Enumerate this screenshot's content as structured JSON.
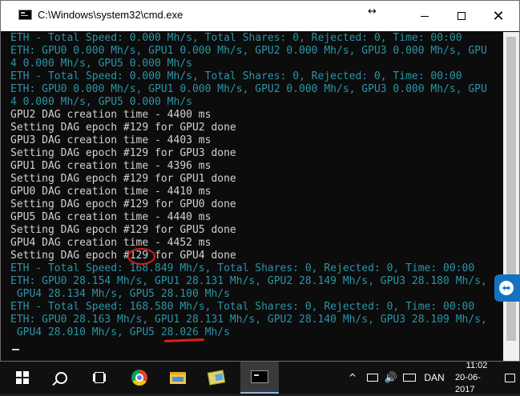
{
  "window": {
    "title": "C:\\Windows\\system32\\cmd.exe",
    "resize_glyph": "↔",
    "close_glyph": "✕"
  },
  "console": {
    "lines": [
      {
        "text": "ETH - Total Speed: 0.000 Mh/s, Total Shares: 0, Rejected: 0, Time: 00:00",
        "color": "teal"
      },
      {
        "text": "ETH: GPU0 0.000 Mh/s, GPU1 0.000 Mh/s, GPU2 0.000 Mh/s, GPU3 0.000 Mh/s, GPU",
        "color": "teal"
      },
      {
        "text": "4 0.000 Mh/s, GPU5 0.000 Mh/s",
        "color": "teal"
      },
      {
        "text": "ETH - Total Speed: 0.000 Mh/s, Total Shares: 0, Rejected: 0, Time: 00:00",
        "color": "teal"
      },
      {
        "text": "ETH: GPU0 0.000 Mh/s, GPU1 0.000 Mh/s, GPU2 0.000 Mh/s, GPU3 0.000 Mh/s, GPU",
        "color": "teal"
      },
      {
        "text": "4 0.000 Mh/s, GPU5 0.000 Mh/s",
        "color": "teal"
      },
      {
        "text": "GPU2 DAG creation time - 4400 ms",
        "color": "gray"
      },
      {
        "text": "Setting DAG epoch #129 for GPU2 done",
        "color": "gray"
      },
      {
        "text": "GPU3 DAG creation time - 4403 ms",
        "color": "gray"
      },
      {
        "text": "Setting DAG epoch #129 for GPU3 done",
        "color": "gray"
      },
      {
        "text": "GPU1 DAG creation time - 4396 ms",
        "color": "gray"
      },
      {
        "text": "Setting DAG epoch #129 for GPU1 done",
        "color": "gray"
      },
      {
        "text": "GPU0 DAG creation time - 4410 ms",
        "color": "gray"
      },
      {
        "text": "Setting DAG epoch #129 for GPU0 done",
        "color": "gray"
      },
      {
        "text": "GPU5 DAG creation time - 4440 ms",
        "color": "gray"
      },
      {
        "text": "Setting DAG epoch #129 for GPU5 done",
        "color": "gray"
      },
      {
        "text": "GPU4 DAG creation time - 4452 ms",
        "color": "gray"
      },
      {
        "text": "Setting DAG epoch #129 for GPU4 done",
        "color": "gray"
      },
      {
        "text": "ETH - Total Speed: 168.849 Mh/s, Total Shares: 0, Rejected: 0, Time: 00:00",
        "color": "teal"
      },
      {
        "text": "ETH: GPU0 28.154 Mh/s, GPU1 28.131 Mh/s, GPU2 28.149 Mh/s, GPU3 28.180 Mh/s,",
        "color": "teal"
      },
      {
        "text": " GPU4 28.134 Mh/s, GPU5 28.100 Mh/s",
        "color": "teal"
      },
      {
        "text": "ETH - Total Speed: 168.580 Mh/s, Total Shares: 0, Rejected: 0, Time: 00:00",
        "color": "teal"
      },
      {
        "text": "ETH: GPU0 28.163 Mh/s, GPU1 28.131 Mh/s, GPU2 28.140 Mh/s, GPU3 28.109 Mh/s,",
        "color": "teal"
      },
      {
        "text": " GPU4 28.010 Mh/s, GPU5 28.026 Mh/s",
        "color": "teal"
      }
    ],
    "colors": {
      "gray": "#d2d2d2",
      "teal": "#2a95a7",
      "annotation": "#e31d1d"
    }
  },
  "taskbar": {
    "language": "DAN",
    "time": "11:02",
    "date": "20-06-2017",
    "tray_chevron": "^",
    "volume_glyph": "🔊",
    "icons": [
      "windows-start-icon",
      "search-icon",
      "task-view-icon",
      "chrome-icon",
      "file-explorer-icon",
      "folder-icon",
      "cmd-icon"
    ]
  }
}
